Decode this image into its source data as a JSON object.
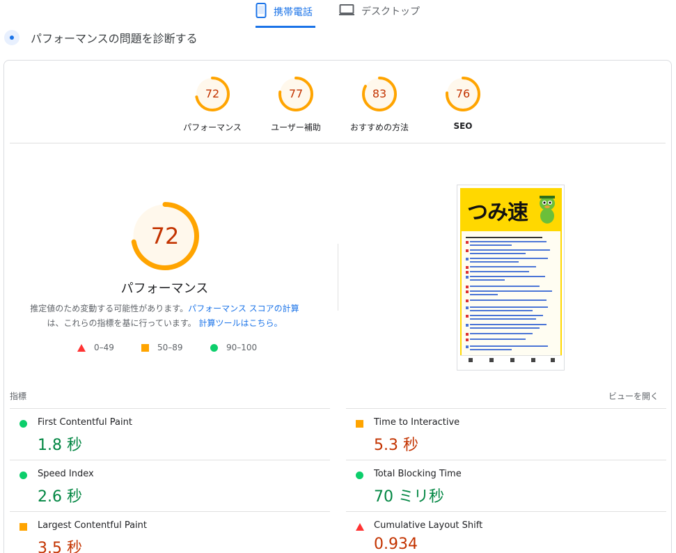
{
  "tabs": {
    "mobile": "携帯電話",
    "desktop": "デスクトップ"
  },
  "section_title": "パフォーマンスの問題を診断する",
  "categories": [
    {
      "score": "72",
      "label": "パフォーマンス",
      "level": 0.72
    },
    {
      "score": "77",
      "label": "ユーザー補助",
      "level": 0.77
    },
    {
      "score": "83",
      "label": "おすすめの方法",
      "level": 0.83
    },
    {
      "score": "76",
      "label": "SEO",
      "level": 0.76
    }
  ],
  "performance": {
    "score": "72",
    "level": 0.72,
    "title": "パフォーマンス",
    "desc_part1": "推定値のため変動する可能性があります。",
    "desc_link1": "パフォーマンス スコアの計算",
    "desc_part2": "は、これらの指標を基に行っています。",
    "desc_link2": "計算ツールはこちら。"
  },
  "legend": {
    "fail": "0–49",
    "average": "50–89",
    "pass": "90–100"
  },
  "screenshot": {
    "logo_text": "つみ速"
  },
  "metrics_header": {
    "label": "指標",
    "expand_view": "ビューを開く"
  },
  "metrics": [
    {
      "name": "First Contentful Paint",
      "value": "1.8 秒",
      "rating": "pass"
    },
    {
      "name": "Time to Interactive",
      "value": "5.3 秒",
      "rating": "average"
    },
    {
      "name": "Speed Index",
      "value": "2.6 秒",
      "rating": "pass"
    },
    {
      "name": "Total Blocking Time",
      "value": "70 ミリ秒",
      "rating": "pass"
    },
    {
      "name": "Largest Contentful Paint",
      "value": "3.5 秒",
      "rating": "average"
    },
    {
      "name": "Cumulative Layout Shift",
      "value": "0.934",
      "rating": "fail"
    }
  ],
  "colors": {
    "accent": "#1a73e8",
    "average": "#ffa400",
    "average_text": "#c33300",
    "pass": "#0cce6b",
    "pass_text": "#018642",
    "fail": "#ff3333"
  }
}
